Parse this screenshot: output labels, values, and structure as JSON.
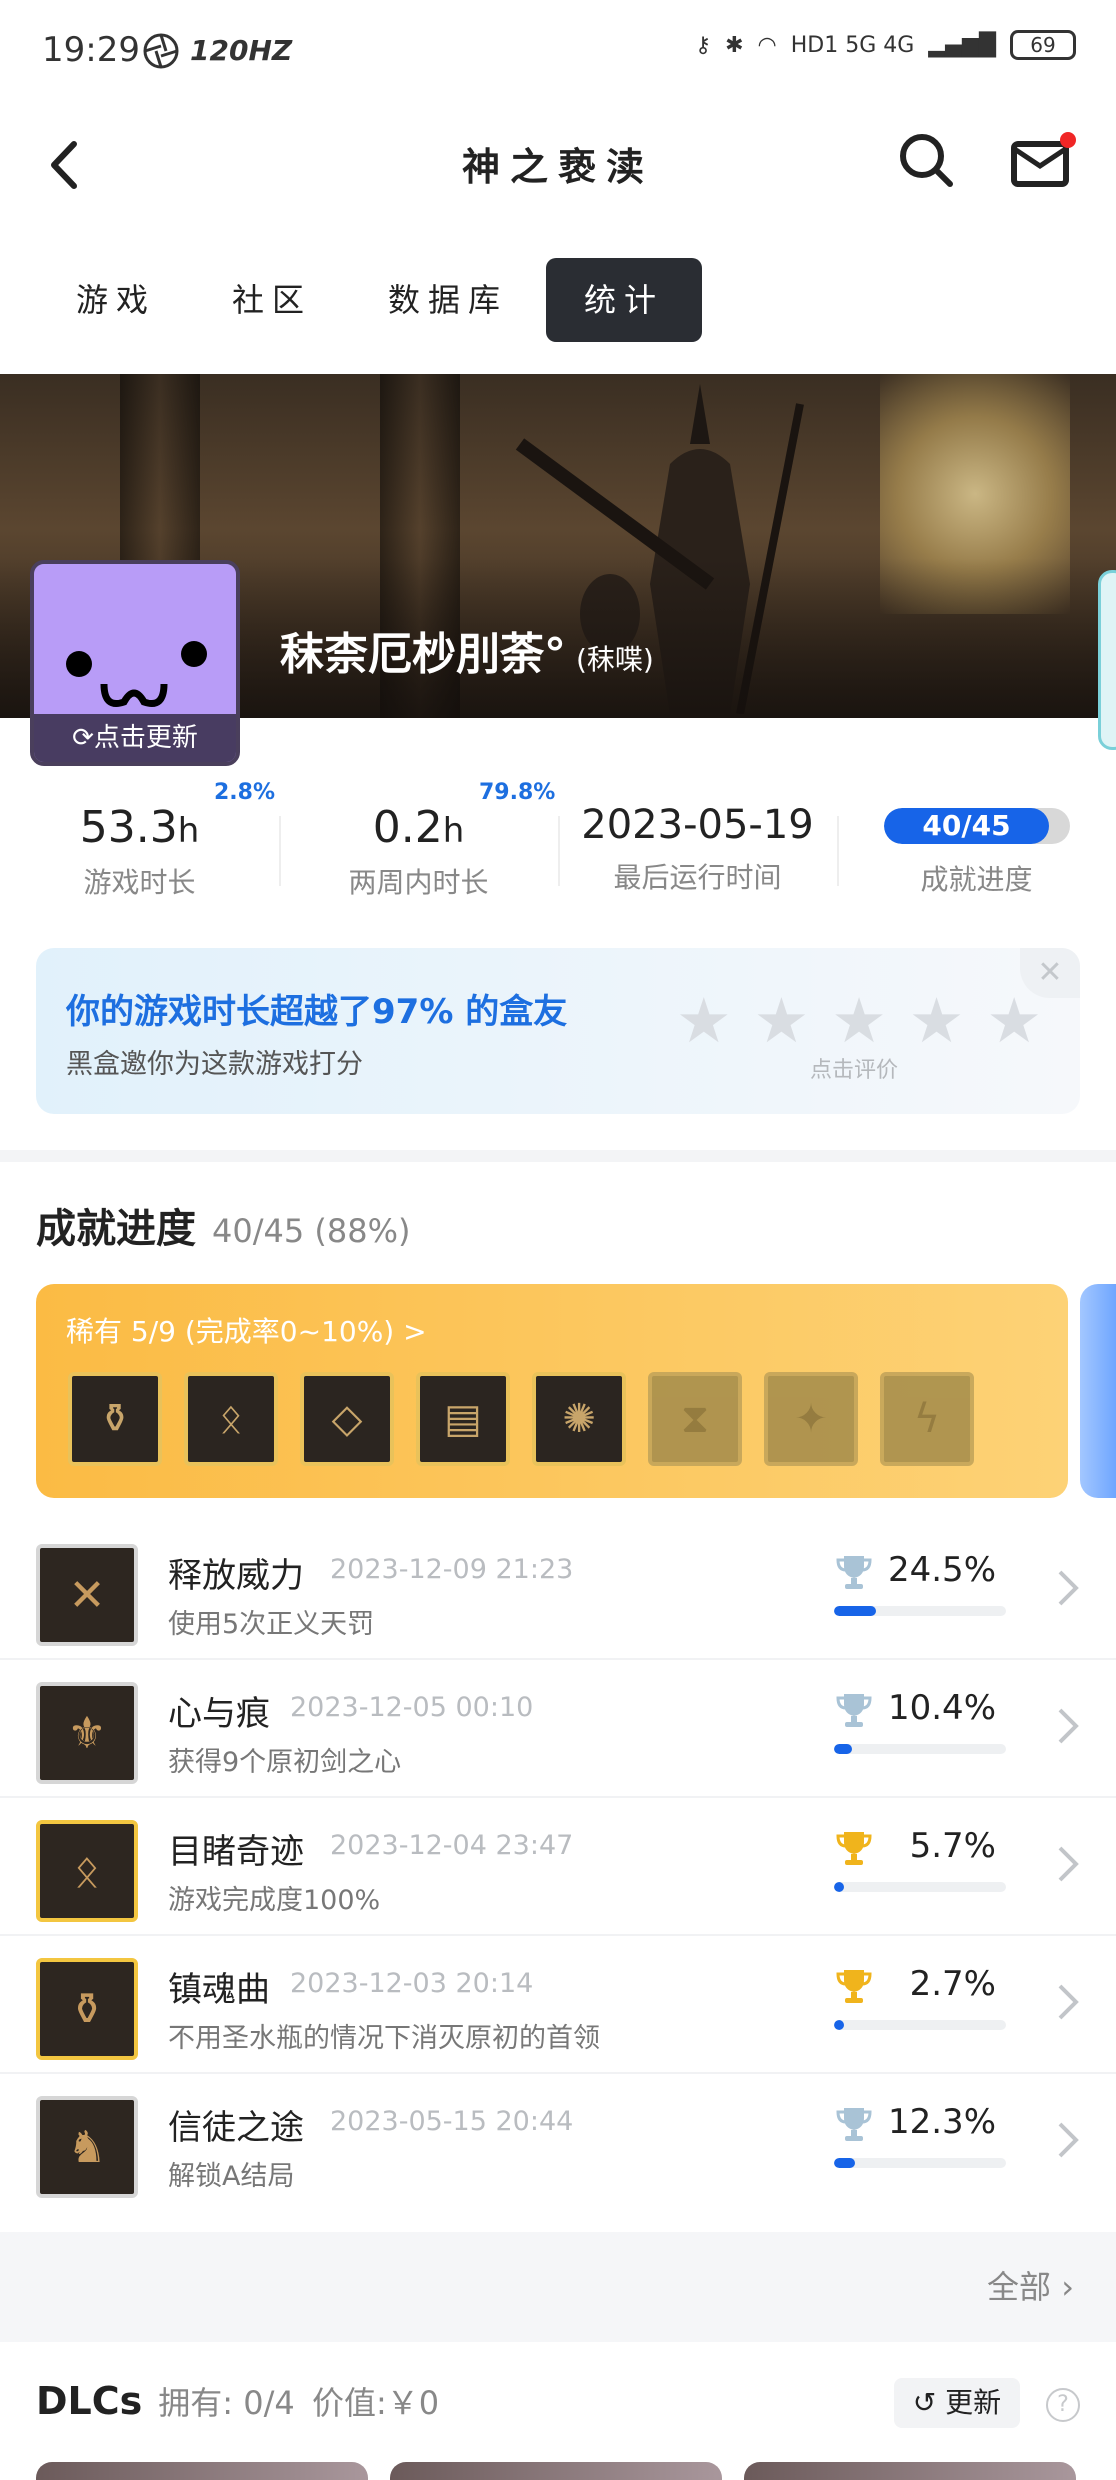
{
  "status_bar": {
    "time": "19:29",
    "hz": "120HZ",
    "network": "HD1 5G 4G",
    "battery": "69"
  },
  "header": {
    "title": "神之亵渎"
  },
  "tabs": [
    {
      "label": "游戏"
    },
    {
      "label": "社区"
    },
    {
      "label": "数据库"
    },
    {
      "label": "统计",
      "active": true
    }
  ],
  "profile": {
    "name": "秣柰厄杪刖荼°",
    "alias": "(秣喋)",
    "avatar_update": "点击更新"
  },
  "stats": [
    {
      "value": "53.3",
      "unit": "h",
      "percent": "2.8%",
      "label": "游戏时长"
    },
    {
      "value": "0.2",
      "unit": "h",
      "percent": "79.8%",
      "label": "两周内时长"
    },
    {
      "value": "2023-05-19",
      "label": "最后运行时间"
    },
    {
      "value": "40/45",
      "label": "成就进度",
      "progress": 0.889
    }
  ],
  "rating": {
    "headline": "你的游戏时长超越了97% 的盒友",
    "sub": "黑盒邀你为这款游戏打分",
    "hint": "点击评价",
    "stars": 5
  },
  "achievements": {
    "title": "成就进度",
    "summary": "40/45 (88%)",
    "rare_label": "稀有 5/9 (完成率0~10%) >",
    "rare_badges": [
      {
        "name": "urn-icon",
        "glyph": "⚱",
        "unlocked": true
      },
      {
        "name": "rune-icon",
        "glyph": "ᛟ",
        "unlocked": true
      },
      {
        "name": "rosary-icon",
        "glyph": "◇",
        "unlocked": true
      },
      {
        "name": "scroll-icon",
        "glyph": "▤",
        "unlocked": true
      },
      {
        "name": "spider-icon",
        "glyph": "✺",
        "unlocked": true
      },
      {
        "name": "hourglass-icon",
        "glyph": "⧗",
        "unlocked": false
      },
      {
        "name": "beast-icon",
        "glyph": "✦",
        "unlocked": false
      },
      {
        "name": "rune-icon",
        "glyph": "ϟ",
        "unlocked": false
      }
    ],
    "list": [
      {
        "name": "释放威力",
        "date": "2023-12-09 21:23",
        "desc": "使用5次正义天罚",
        "percent": "24.5%",
        "rate": 0.245,
        "trophy": "silver",
        "frame": "gray",
        "glyph": "✕"
      },
      {
        "name": "心与痕",
        "date": "2023-12-05 00:10",
        "desc": "获得9个原初剑之心",
        "percent": "10.4%",
        "rate": 0.104,
        "trophy": "silver",
        "frame": "gray",
        "glyph": "⚜"
      },
      {
        "name": "目睹奇迹",
        "date": "2023-12-04 23:47",
        "desc": "游戏完成度100%",
        "percent": "5.7%",
        "rate": 0.057,
        "trophy": "gold",
        "frame": "gold",
        "glyph": "ᛟ"
      },
      {
        "name": "镇魂曲",
        "date": "2023-12-03 20:14",
        "desc": "不用圣水瓶的情况下消灭原初的首领",
        "percent": "2.7%",
        "rate": 0.027,
        "trophy": "gold",
        "frame": "gold",
        "glyph": "⚱"
      },
      {
        "name": "信徒之途",
        "date": "2023-05-15 20:44",
        "desc": "解锁A结局",
        "percent": "12.3%",
        "rate": 0.123,
        "trophy": "silver",
        "frame": "gray",
        "glyph": "♞"
      }
    ],
    "all_label": "全部"
  },
  "dlc": {
    "title": "DLCs",
    "owned": "拥有: 0/4",
    "value": "价值:￥0",
    "update_label": "更新",
    "help": "?"
  },
  "colors": {
    "accent": "#1764e8",
    "tab_active_bg": "#2a2d33",
    "rare_gold": "#fbbb44",
    "trophy_gold": "#f0b41c",
    "trophy_silver": "#a9c3d6"
  }
}
